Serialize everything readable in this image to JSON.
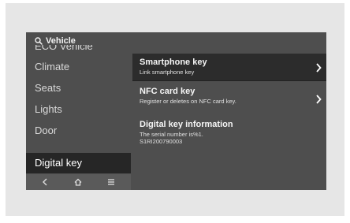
{
  "search": {
    "label": "Vehicle",
    "icon": "search-icon"
  },
  "sidebar": {
    "items": [
      {
        "label": "ECO Vehicle"
      },
      {
        "label": "Climate"
      },
      {
        "label": "Seats"
      },
      {
        "label": "Lights"
      },
      {
        "label": "Door"
      },
      {
        "label": "Digital key",
        "selected": true
      }
    ]
  },
  "bottom_nav": {
    "icons": [
      "back-icon",
      "home-icon",
      "menu-icon"
    ]
  },
  "content": {
    "items": [
      {
        "title": "Smartphone key",
        "subtitle": "Link smartphone key",
        "has_chevron": true,
        "highlighted": true
      },
      {
        "title": "NFC card key",
        "subtitle": "Register or deletes on NFC card key.",
        "has_chevron": true,
        "highlighted": false
      },
      {
        "title": "Digital key information",
        "subtitle_lines": [
          "The serial number is%1.",
          "S1RI200790003"
        ],
        "has_chevron": false,
        "highlighted": false
      }
    ]
  },
  "colors": {
    "screen_bg": "#4e4e4e",
    "selected_bg": "#262626",
    "frame_bg": "#e6e6e6"
  }
}
